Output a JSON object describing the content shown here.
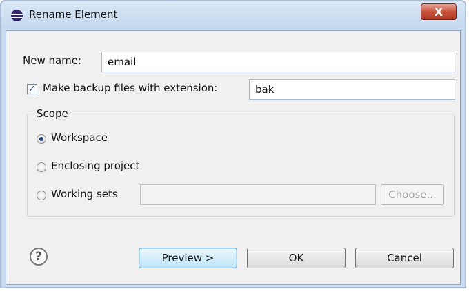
{
  "window": {
    "title": "Rename Element",
    "close_label": "X"
  },
  "form": {
    "new_name_label": "New name:",
    "new_name_value": "email",
    "backup_checkbox_label": "Make backup files with extension:",
    "backup_checked": true,
    "backup_extension_value": "bak"
  },
  "scope": {
    "title": "Scope",
    "options": [
      {
        "label": "Workspace",
        "selected": true
      },
      {
        "label": "Enclosing project",
        "selected": false
      },
      {
        "label": "Working sets",
        "selected": false
      }
    ],
    "working_sets_value": "",
    "choose_label": "Choose..."
  },
  "buttons": {
    "help_glyph": "?",
    "preview_label": "Preview >",
    "ok_label": "OK",
    "cancel_label": "Cancel"
  },
  "icons": {
    "app": "eclipse-icon",
    "help": "help-icon",
    "close": "close-icon"
  },
  "colors": {
    "titlebar": "#c8dcf0",
    "close_button": "#c8533c",
    "default_button": "#bfe5f8",
    "radio_dot": "#1b3f7a"
  }
}
